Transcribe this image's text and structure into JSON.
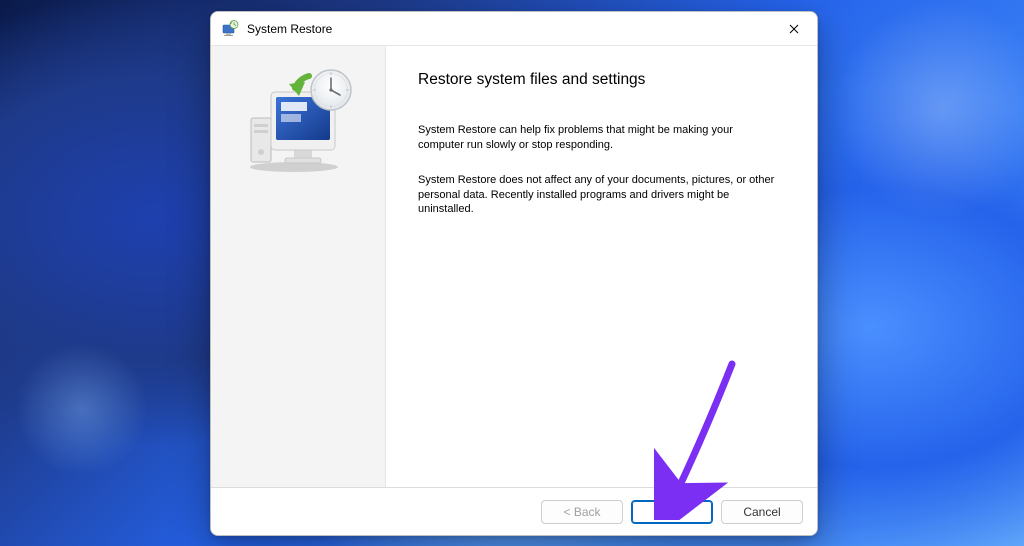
{
  "window": {
    "title": "System Restore"
  },
  "content": {
    "heading": "Restore system files and settings",
    "paragraph1": "System Restore can help fix problems that might be making your computer run slowly or stop responding.",
    "paragraph2": "System Restore does not affect any of your documents, pictures, or other personal data. Recently installed programs and drivers might be uninstalled."
  },
  "buttons": {
    "back": "< Back",
    "next": "Next >",
    "cancel": "Cancel"
  },
  "annotation": {
    "color": "#7b2ff2"
  }
}
